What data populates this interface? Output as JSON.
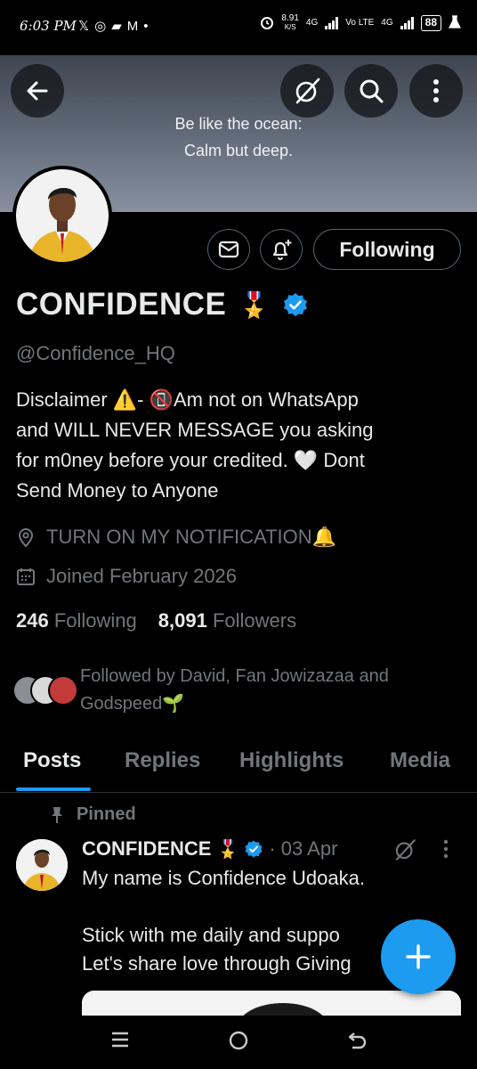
{
  "status_bar": {
    "time": "6:03 PM",
    "left_icons": [
      "x-icon",
      "whatsapp-icon",
      "chat-icon",
      "gmail-icon",
      "dot-icon"
    ],
    "net_speed": "8.91",
    "net_speed_unit": "K/S",
    "network_a": "4G",
    "network_b": "Vo LTE",
    "network_c": "4G",
    "battery": "88"
  },
  "banner": {
    "line1": "Be like the ocean:",
    "line2": "Calm but deep."
  },
  "profile": {
    "display_name": "CONFIDENCE",
    "name_emoji": "🎖️",
    "handle": "@Confidence_HQ",
    "bio": [
      "Disclaimer ⚠️- 📵Am not on WhatsApp",
      "and WILL NEVER MESSAGE you asking",
      "for m0ney before your credited.  🤍 Dont",
      "Send Money to Anyone"
    ],
    "location": "TURN ON MY NOTIFICATION🔔",
    "joined": "Joined February 2026",
    "following_count": "246",
    "following_label": "Following",
    "followers_count": "8,091",
    "followers_label": "Followers",
    "followed_by": "Followed by David, Fan Jowizazaa and Godspeed🌱"
  },
  "actions": {
    "following_button": "Following"
  },
  "tabs": [
    "Posts",
    "Replies",
    "Highlights",
    "Media"
  ],
  "post": {
    "pinned_label": "Pinned",
    "author": "CONFIDENCE",
    "author_emoji": "🎖️",
    "date": "· 03 Apr",
    "lines": [
      "My name is Confidence Udoaka.",
      "",
      "Stick with me daily and suppo",
      "Let's share love through Giving"
    ]
  },
  "colors": {
    "accent": "#1d9bf0",
    "muted": "#71767b",
    "text": "#e7e9ea",
    "border": "#536471",
    "background": "#000000"
  }
}
